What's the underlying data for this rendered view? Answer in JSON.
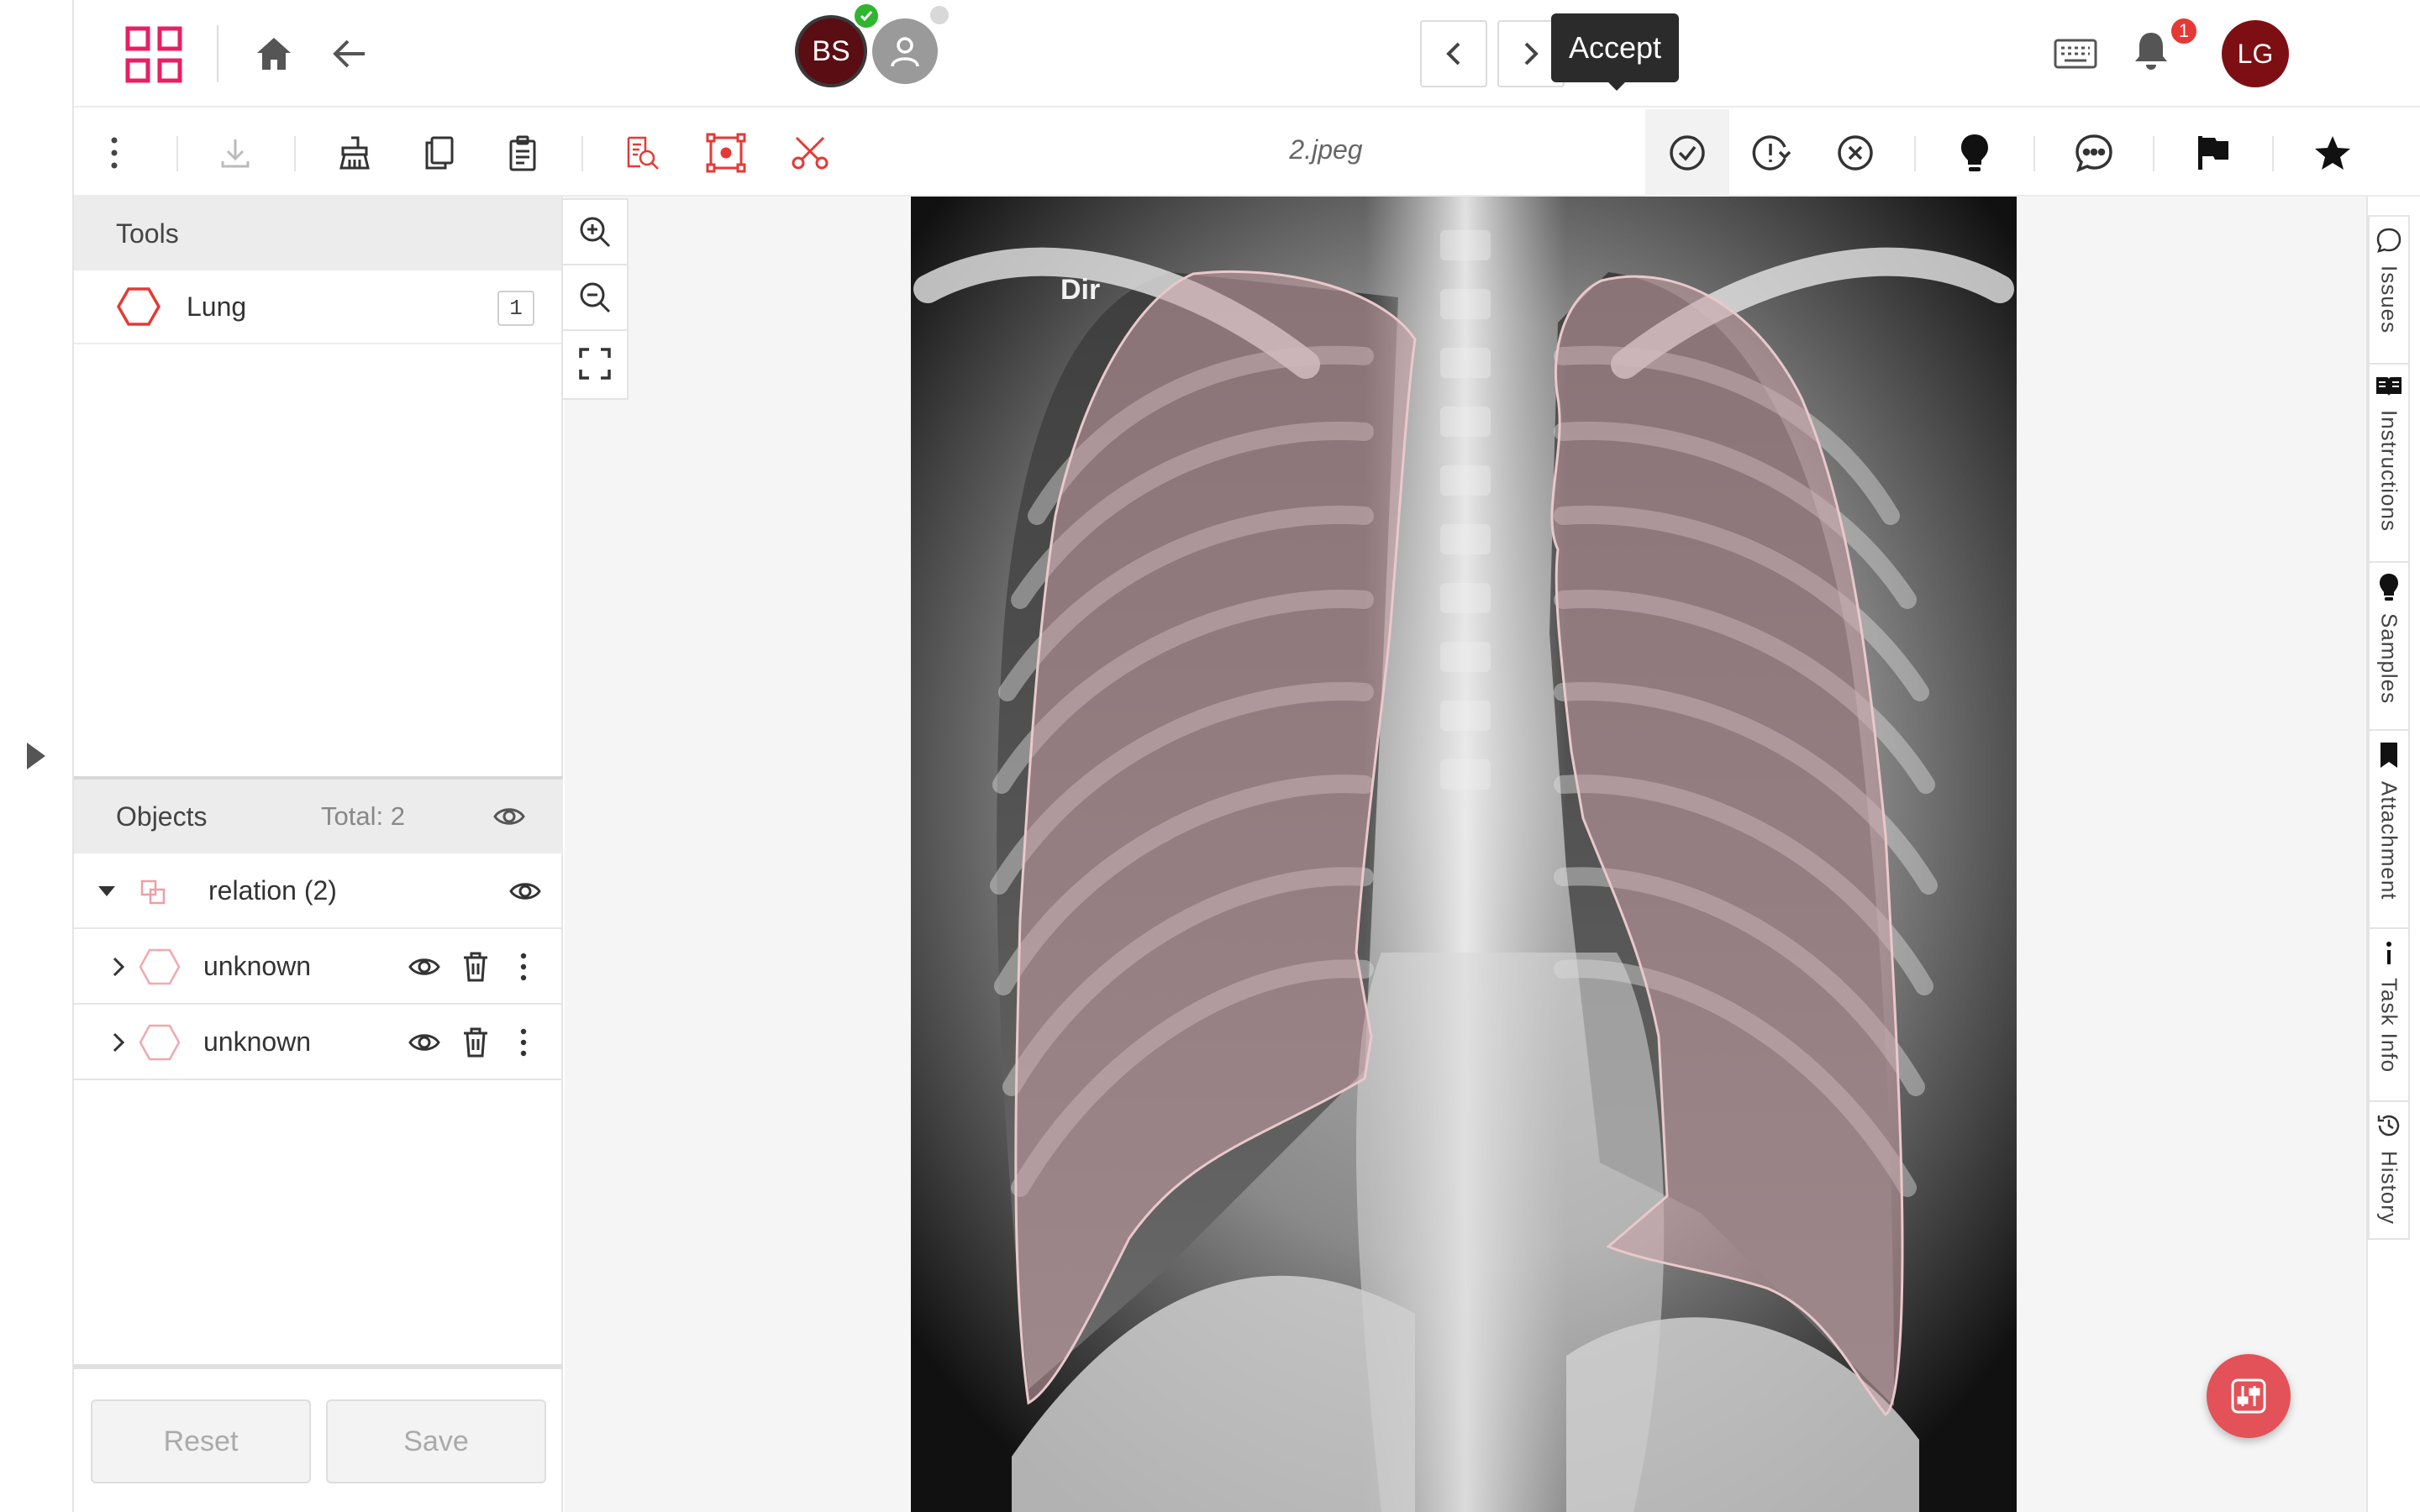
{
  "header": {
    "avatars": [
      {
        "initials": "BS",
        "color": "#5a0d12",
        "status": "check"
      },
      {
        "icon": "user-icon",
        "color": "#9a9a9a"
      }
    ],
    "tooltip": "Accept",
    "notification_count": "1",
    "user_initials": "LG",
    "user_color": "#7d0f14"
  },
  "toolbar": {
    "filename": "2.jpeg"
  },
  "tools": {
    "title": "Tools",
    "items": [
      {
        "label": "Lung",
        "count": "1",
        "icon": "hexagon-icon",
        "color": "#e53935"
      }
    ]
  },
  "objects": {
    "title": "Objects",
    "total": "Total: 2",
    "group": {
      "label": "relation (2)"
    },
    "items": [
      {
        "label": "unknown"
      },
      {
        "label": "unknown"
      }
    ]
  },
  "footer": {
    "reset_label": "Reset",
    "save_label": "Save"
  },
  "canvas": {
    "overlay_text": "Dir"
  },
  "right_sidebar": {
    "tabs": [
      {
        "label": "Issues",
        "icon": "comment-icon"
      },
      {
        "label": "Instructions",
        "icon": "book-icon"
      },
      {
        "label": "Samples",
        "icon": "bulb-icon"
      },
      {
        "label": "Attachment",
        "icon": "bookmark-icon"
      },
      {
        "label": "Task Info",
        "icon": "info-icon"
      },
      {
        "label": "History",
        "icon": "clock-icon"
      }
    ]
  },
  "colors": {
    "brand": "#e91e63",
    "accent_red": "#e53935",
    "fab": "#e25258"
  }
}
